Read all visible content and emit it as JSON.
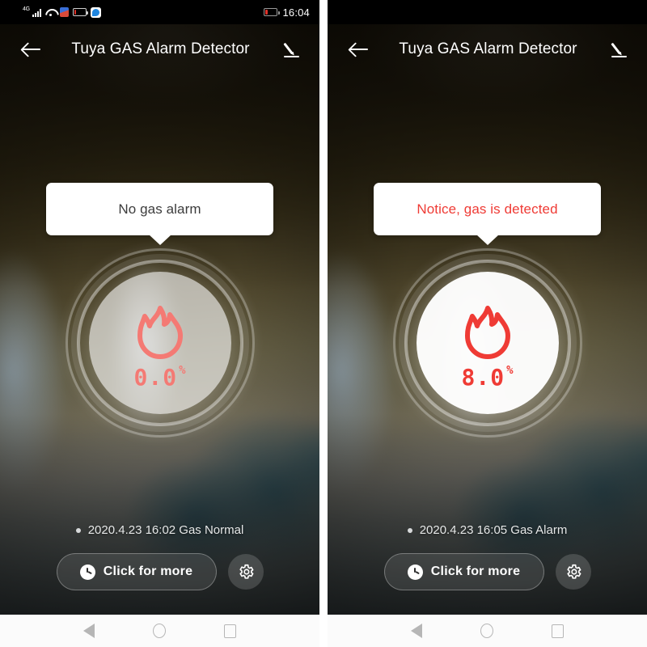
{
  "app": {
    "title": "Tuya GAS Alarm Detector",
    "back_icon": "back-arrow-icon",
    "edit_icon": "edit-pencil-icon"
  },
  "colors": {
    "alarm_red": "#ef3b35",
    "normal_salmon": "#f47a74",
    "card_white": "#ffffff",
    "status_text": "#e6e8e8"
  },
  "navbar": {
    "back_label": "back",
    "home_label": "home",
    "recents_label": "recents"
  },
  "phones": [
    {
      "id": "phone-normal",
      "statusbar": {
        "visible_icons": true,
        "network": "4G",
        "signal_icon": "signal-bars-icon",
        "wifi_icon": "wifi-icon",
        "app_icon_1": "app-badge-icon",
        "app_icon_2": "cloud-app-icon",
        "battery_icon": "battery-low-icon",
        "time": "16:04"
      },
      "tooltip": {
        "text": "No gas alarm",
        "state": "normal"
      },
      "gauge": {
        "icon": "flame-icon",
        "value": "0.0",
        "unit": "%",
        "state": "normal"
      },
      "status": {
        "text": "2020.4.23 16:02 Gas Normal",
        "dot_icon": "status-dot-icon"
      },
      "actions": {
        "more_label": "Click for more",
        "more_icon": "clock-icon",
        "settings_icon": "gear-icon"
      }
    },
    {
      "id": "phone-alarm",
      "statusbar": {
        "visible_icons": false,
        "network": "",
        "signal_icon": "",
        "wifi_icon": "",
        "app_icon_1": "",
        "app_icon_2": "",
        "battery_icon": "",
        "time": ""
      },
      "tooltip": {
        "text": "Notice, gas is detected",
        "state": "alarm"
      },
      "gauge": {
        "icon": "flame-icon",
        "value": "8.0",
        "unit": "%",
        "state": "alarm"
      },
      "status": {
        "text": "2020.4.23 16:05 Gas Alarm",
        "dot_icon": "status-dot-icon"
      },
      "actions": {
        "more_label": "Click for more",
        "more_icon": "clock-icon",
        "settings_icon": "gear-icon"
      }
    }
  ]
}
